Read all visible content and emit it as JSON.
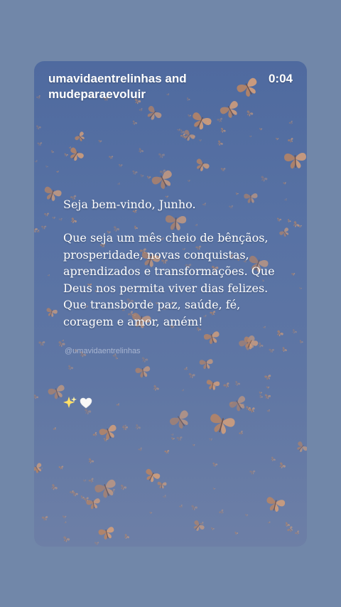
{
  "story": {
    "accounts": "umavidaentrelinhas and mudeparaevoluir",
    "elapsed_time": "0:04",
    "greeting": "Seja bem-vindo, Junho.",
    "body": "Que seja um mês cheio de bênçãos, prosperidade, novas conquistas, aprendizados e transformações. Que Deus nos permita viver dias felizes. Que transborde paz, saúde, fé, coragem e amor, amém!",
    "watermark": "@umavidaentrelinhas",
    "emoji": "✨🤍"
  },
  "colors": {
    "page_background": "#7187a9",
    "story_background": "#566fa2",
    "butterfly_primary": "#b98564",
    "butterfly_secondary": "#d6a07a",
    "text": "#ffffff"
  },
  "icons": {
    "sparkles": "sparkles-icon",
    "heart": "white-heart-icon"
  }
}
